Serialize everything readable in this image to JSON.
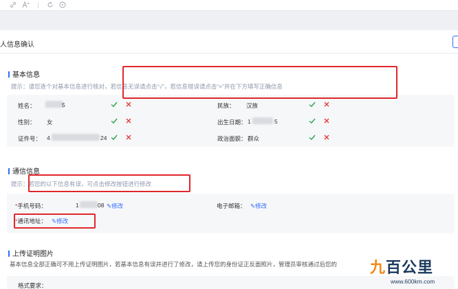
{
  "page": {
    "title": "人信息确认"
  },
  "toolbar": {
    "icons": [
      "link-icon",
      "font-size-icon",
      "refresh-icon",
      "compass-icon"
    ]
  },
  "basic_info": {
    "title": "基本信息",
    "hint": "提示：请您逐个对基本信息进行核对，若信息无误请点击“√”，若信息错误请点击“×”并在下方填写正确信息",
    "fields": {
      "name": {
        "label": "姓名：",
        "value_suffix": "5"
      },
      "ethnicity": {
        "label": "民族：",
        "value": "汉族"
      },
      "gender": {
        "label": "性别：",
        "value": "女"
      },
      "birth": {
        "label": "出生日期：",
        "value_prefix": "1",
        "value_suffix": "5"
      },
      "id_number": {
        "label": "证件号：",
        "value_prefix": "4",
        "value_suffix": "24"
      },
      "political": {
        "label": "政治面貌：",
        "value": "群众"
      }
    }
  },
  "contact_info": {
    "title": "通信信息",
    "hint_prefix": "提示：",
    "hint": "若您的以下信息有误，可点击修改按钮进行修改",
    "phone": {
      "required_mark": "*",
      "label": "手机号码：",
      "value_prefix": "1",
      "value_suffix": "08",
      "edit_label": "修改"
    },
    "email": {
      "label": "电子邮箱：",
      "edit_label": "修改"
    },
    "address": {
      "required_mark": "*",
      "label": "通讯地址：",
      "edit_label": "修改"
    }
  },
  "upload": {
    "title": "上传证明图片",
    "hint": "基本信息全部正确可不用上传证明图片，若基本信息有误并进行了修改，请上传您的身份证正反面照片，管理员审核通过后您的",
    "format_label": "格式要求："
  },
  "watermark": {
    "logo_orange": "九",
    "logo_dark": "百公里",
    "url": "www.600km.com"
  },
  "colors": {
    "accent": "#2f6cff",
    "check": "#2aa34a",
    "cross": "#e53935",
    "highlight": "#e0262a"
  }
}
